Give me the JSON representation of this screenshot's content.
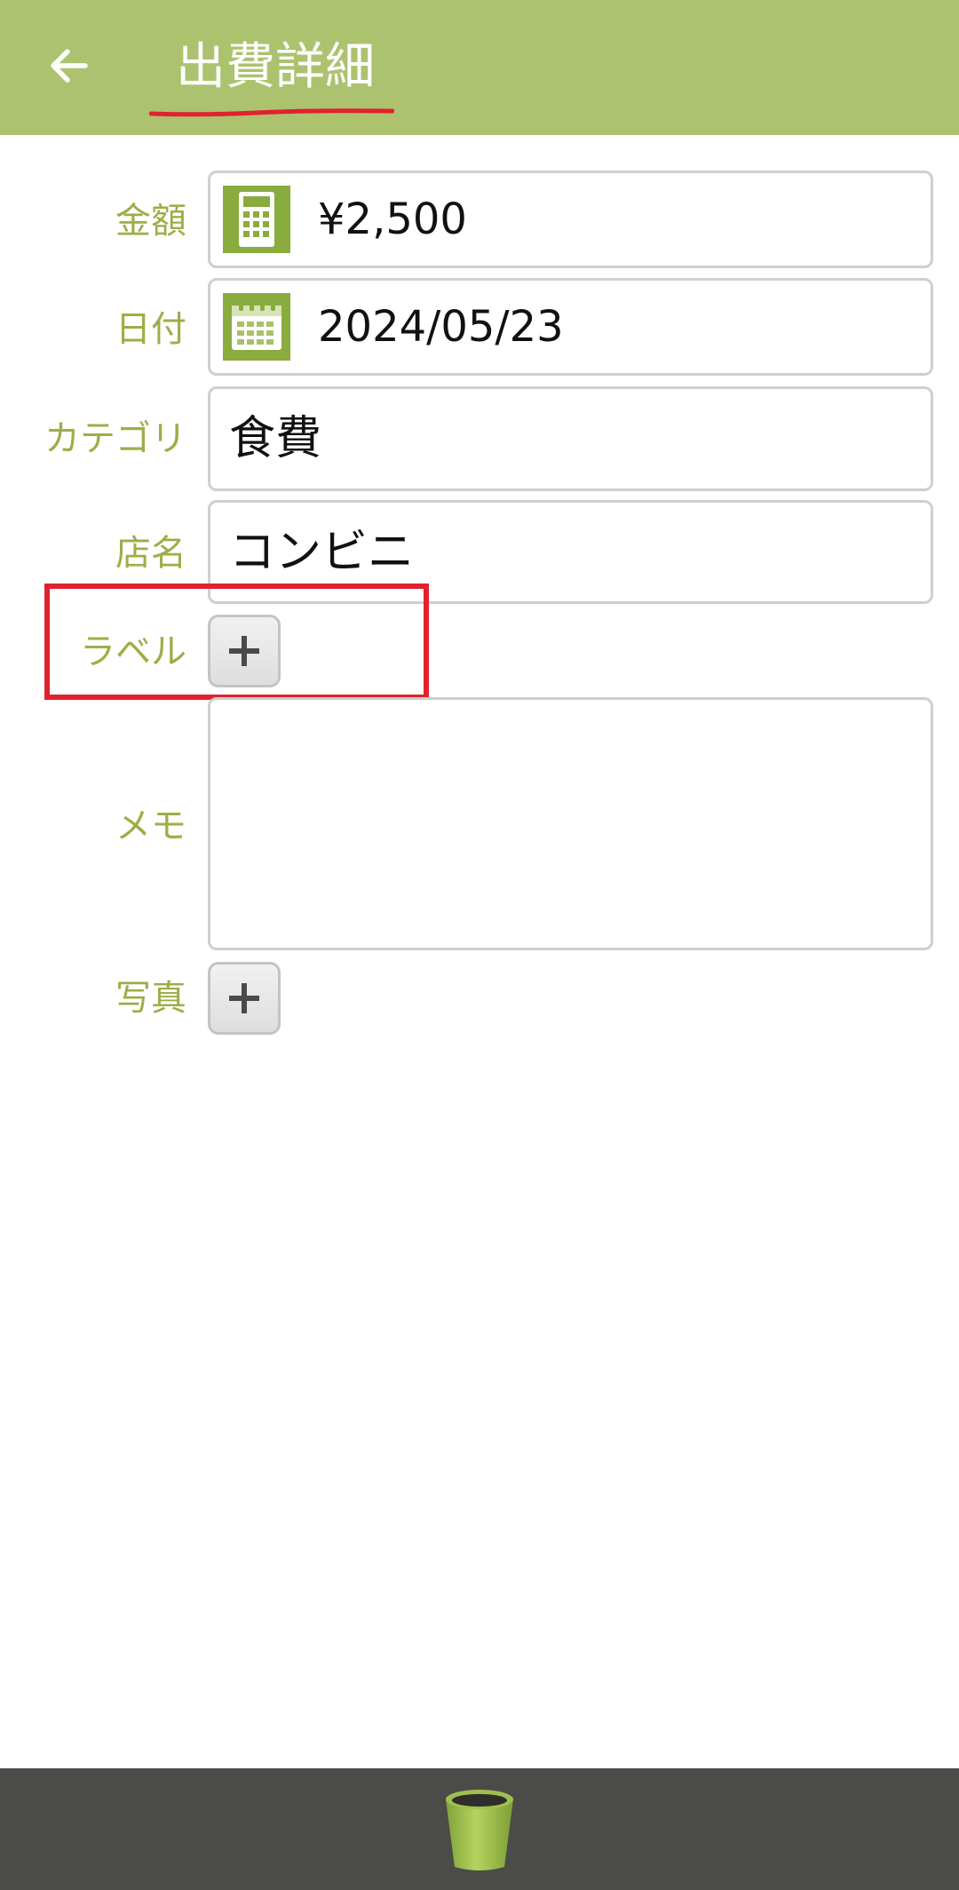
{
  "header": {
    "title": "出費詳細",
    "back_icon": "arrow-left-icon",
    "background_color": "#adc26f",
    "underline_color": "#e0222e"
  },
  "form": {
    "amount": {
      "label": "金額",
      "value": "¥2,500",
      "icon": "calculator-icon"
    },
    "date": {
      "label": "日付",
      "value": "2024/05/23",
      "icon": "calendar-icon"
    },
    "category": {
      "label": "カテゴリ",
      "value": "食費"
    },
    "store": {
      "label": "店名",
      "value": "コンビニ"
    },
    "labels": {
      "label": "ラベル",
      "add_icon": "plus-icon"
    },
    "memo": {
      "label": "メモ",
      "value": ""
    },
    "photo": {
      "label": "写真",
      "add_icon": "plus-icon"
    }
  },
  "annotation": {
    "highlight_color": "#e0222e",
    "target": "labels"
  },
  "bottom_bar": {
    "delete_icon": "trash-icon",
    "background_color": "#4b4b49"
  },
  "colors": {
    "label_text": "#9caf46",
    "icon_green": "#8aab3e"
  }
}
